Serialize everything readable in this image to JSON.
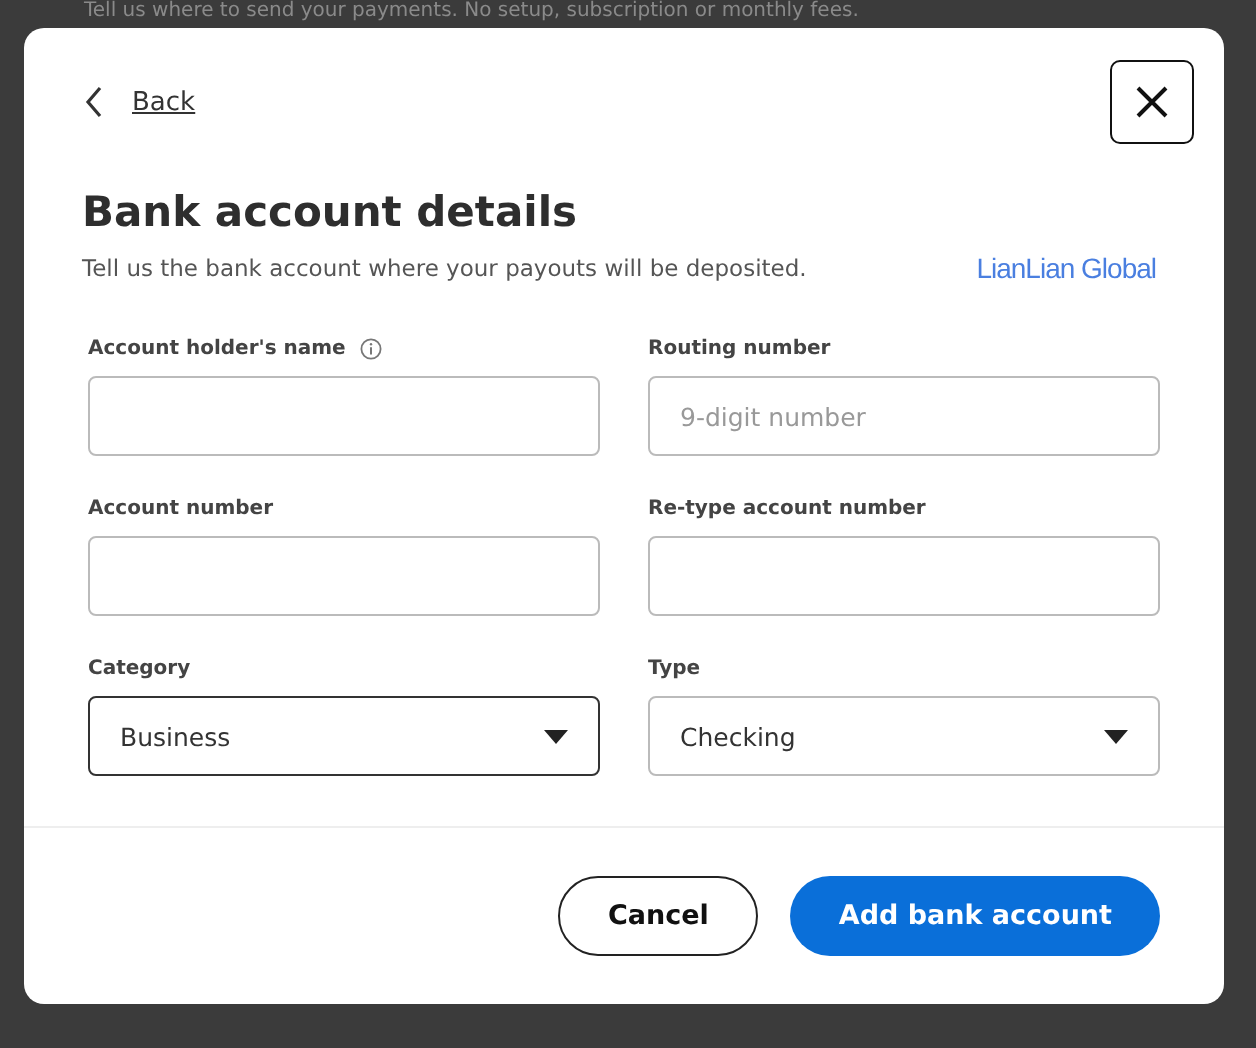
{
  "backdrop": {
    "text": "Tell us where to send your payments. No setup, subscription or monthly fees."
  },
  "dialog": {
    "back_link": "Back",
    "title": "Bank account details",
    "subtitle": "Tell us the bank account where your payouts will be deposited.",
    "partner_logo": "LianLian Global",
    "fields": [
      {
        "kind": "text",
        "label": "Account holder's name",
        "info": true,
        "focused": false
      },
      {
        "kind": "text",
        "label": "Routing number",
        "info": false,
        "placeholder": "9-digit number",
        "focused": false
      },
      {
        "kind": "text",
        "label": "Account number",
        "info": false,
        "focused": false
      },
      {
        "kind": "text",
        "label": "Re-type account number",
        "info": false,
        "focused": false
      },
      {
        "kind": "select",
        "label": "Category",
        "info": false,
        "value": "Business",
        "focused": true
      },
      {
        "kind": "select",
        "label": "Type",
        "info": false,
        "value": "Checking",
        "focused": false
      }
    ],
    "buttons": [
      {
        "kind": "secondary",
        "label": "Cancel"
      },
      {
        "kind": "primary",
        "label": "Add bank account"
      }
    ]
  }
}
